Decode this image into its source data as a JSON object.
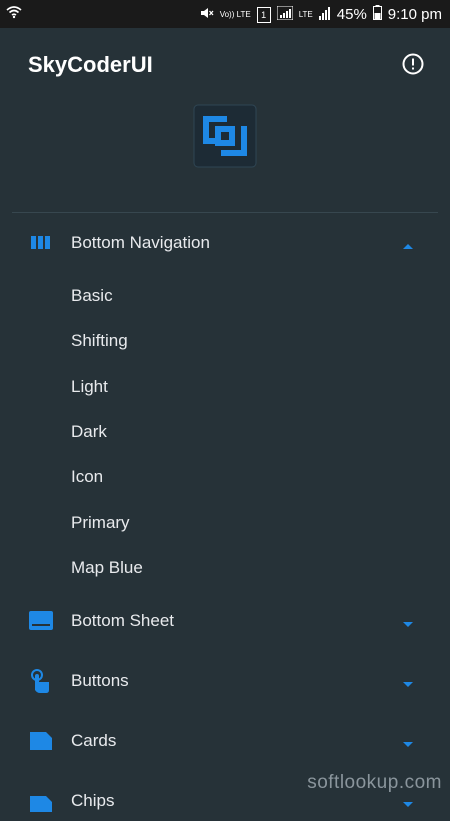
{
  "status_bar": {
    "volte": "Vo)) LTE",
    "sim": "1",
    "lte": "LTE",
    "battery": "45%",
    "time": "9:10 pm"
  },
  "header": {
    "title": "SkyCoderUI"
  },
  "menu": {
    "expanded": {
      "label": "Bottom Navigation",
      "state": "expanded"
    },
    "sub_items": [
      "Basic",
      "Shifting",
      "Light",
      "Dark",
      "Icon",
      "Primary",
      "Map Blue"
    ],
    "collapsed": [
      {
        "label": "Bottom Sheet",
        "icon": "bottom-sheet-icon"
      },
      {
        "label": "Buttons",
        "icon": "touch-icon"
      },
      {
        "label": "Cards",
        "icon": "card-icon"
      },
      {
        "label": "Chips",
        "icon": "chip-icon"
      }
    ]
  },
  "watermark": "softlookup.com",
  "colors": {
    "accent": "#1e88e5",
    "background": "#263238",
    "statusbar": "#1a1a1a"
  }
}
